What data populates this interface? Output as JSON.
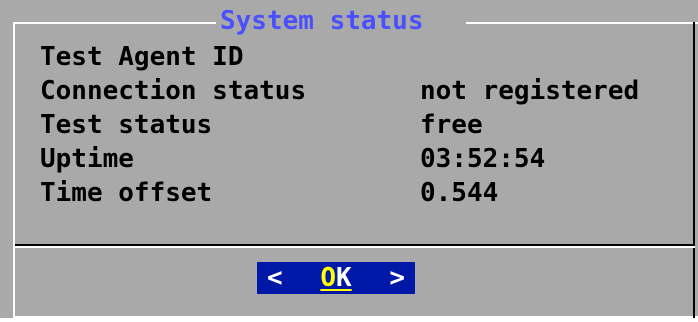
{
  "dialog": {
    "title": "System status",
    "rows": [
      {
        "label": "Test Agent ID",
        "value": ""
      },
      {
        "label": "Connection status",
        "value": "not registered"
      },
      {
        "label": "Test status",
        "value": "free"
      },
      {
        "label": "Uptime",
        "value": "03:52:54"
      },
      {
        "label": "Time offset",
        "value": "0.544"
      }
    ],
    "ok_button": {
      "left_bracket": "<",
      "hotkey": "O",
      "rest": "K",
      "right_bracket": ">"
    }
  },
  "colors": {
    "background": "#a9a9a9",
    "title": "#4b50ff",
    "button_bg": "#0018a8",
    "button_hotkey": "#ffff00"
  }
}
